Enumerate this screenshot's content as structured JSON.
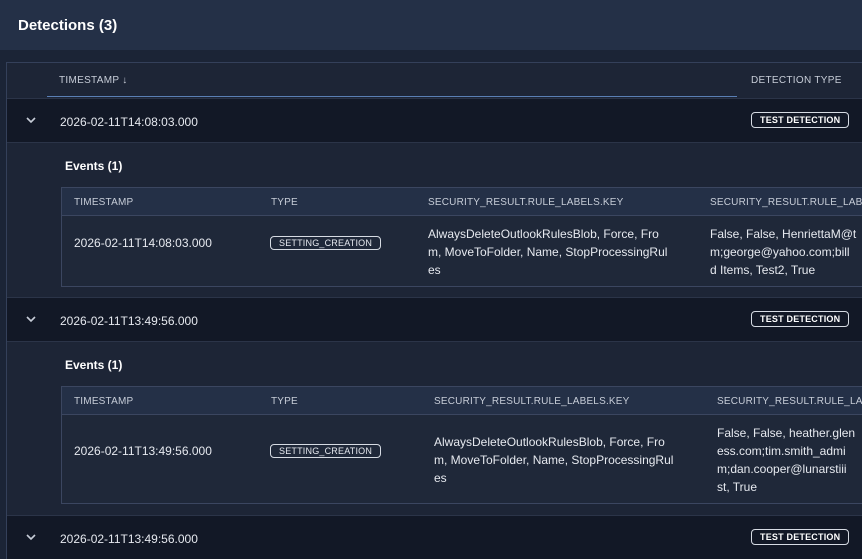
{
  "title": "Detections (3)",
  "columns": {
    "timestamp": "TIMESTAMP ↓",
    "detection_type": "DETECTION TYPE"
  },
  "rows": [
    {
      "timestamp": "2026-02-11T14:08:03.000",
      "badge": "TEST DETECTION"
    },
    {
      "timestamp": "2026-02-11T13:49:56.000",
      "badge": "TEST DETECTION"
    },
    {
      "timestamp": "2026-02-11T13:49:56.000",
      "badge": "TEST DETECTION"
    }
  ],
  "details": [
    {
      "events_title": "Events (1)",
      "headers": [
        "TIMESTAMP",
        "TYPE",
        "SECURITY_RESULT.RULE_LABELS.KEY",
        "SECURITY_RESULT.RULE_LABE"
      ],
      "cells": {
        "timestamp": "2026-02-11T14:08:03.000",
        "type": "SETTING_CREATION",
        "key_lines": [
          "AlwaysDeleteOutlookRulesBlob, Force, Fro",
          "m, MoveToFolder, Name, StopProcessingRul",
          "es"
        ],
        "value_lines": [
          "False, False, HenriettaM@t",
          "m;george@yahoo.com;bill",
          "d Items, Test2, True"
        ]
      }
    },
    {
      "events_title": "Events (1)",
      "headers": [
        "TIMESTAMP",
        "TYPE",
        "SECURITY_RESULT.RULE_LABELS.KEY",
        "SECURITY_RESULT.RULE_LAB"
      ],
      "cells": {
        "timestamp": "2026-02-11T13:49:56.000",
        "type": "SETTING_CREATION",
        "key_lines": [
          "AlwaysDeleteOutlookRulesBlob, Force, Fro",
          "m, MoveToFolder, Name, StopProcessingRul",
          "es"
        ],
        "value_lines": [
          "False, False, heather.glen",
          "ess.com;tim.smith_admi",
          "m;dan.cooper@lunarstiii",
          "st, True"
        ]
      }
    }
  ]
}
